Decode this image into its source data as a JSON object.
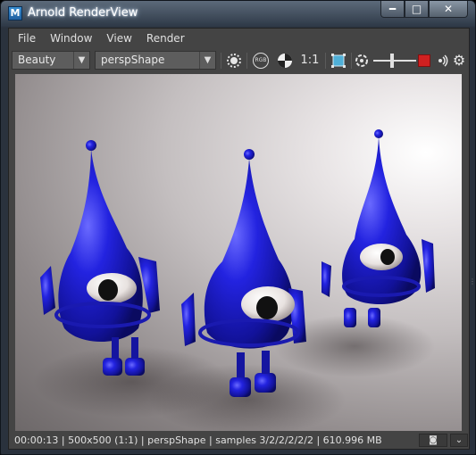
{
  "window": {
    "title": "Arnold RenderView",
    "app_icon_letter": "M",
    "minimize_glyph": "━",
    "maximize_glyph": "□",
    "close_glyph": "✕"
  },
  "menu": [
    {
      "label": "File"
    },
    {
      "label": "Window"
    },
    {
      "label": "View"
    },
    {
      "label": "Render"
    }
  ],
  "toolbar": {
    "aov": "Beauty",
    "camera": "perspShape",
    "rgb_label": "RGB",
    "ratio_label": "1:1",
    "icons": [
      "channel-circle-icon",
      "rgb-icon",
      "exposure-pie-icon",
      "crop-region-icon",
      "refresh-icon",
      "stop-render-icon",
      "ipr-broadcast-icon",
      "settings-gear-icon"
    ],
    "stop_color": "#d02020",
    "crop_color": "#4fb0d8"
  },
  "status": {
    "text": "00:00:13 | 500x500 (1:1) | perspShape  | samples 3/2/2/2/2/2 | 610.996 MB",
    "snapshot_icon": "camera-icon",
    "expand_icon": "chevron-down-icon"
  },
  "colors": {
    "character": "#1f1fc8",
    "background": "#cfcaca"
  }
}
